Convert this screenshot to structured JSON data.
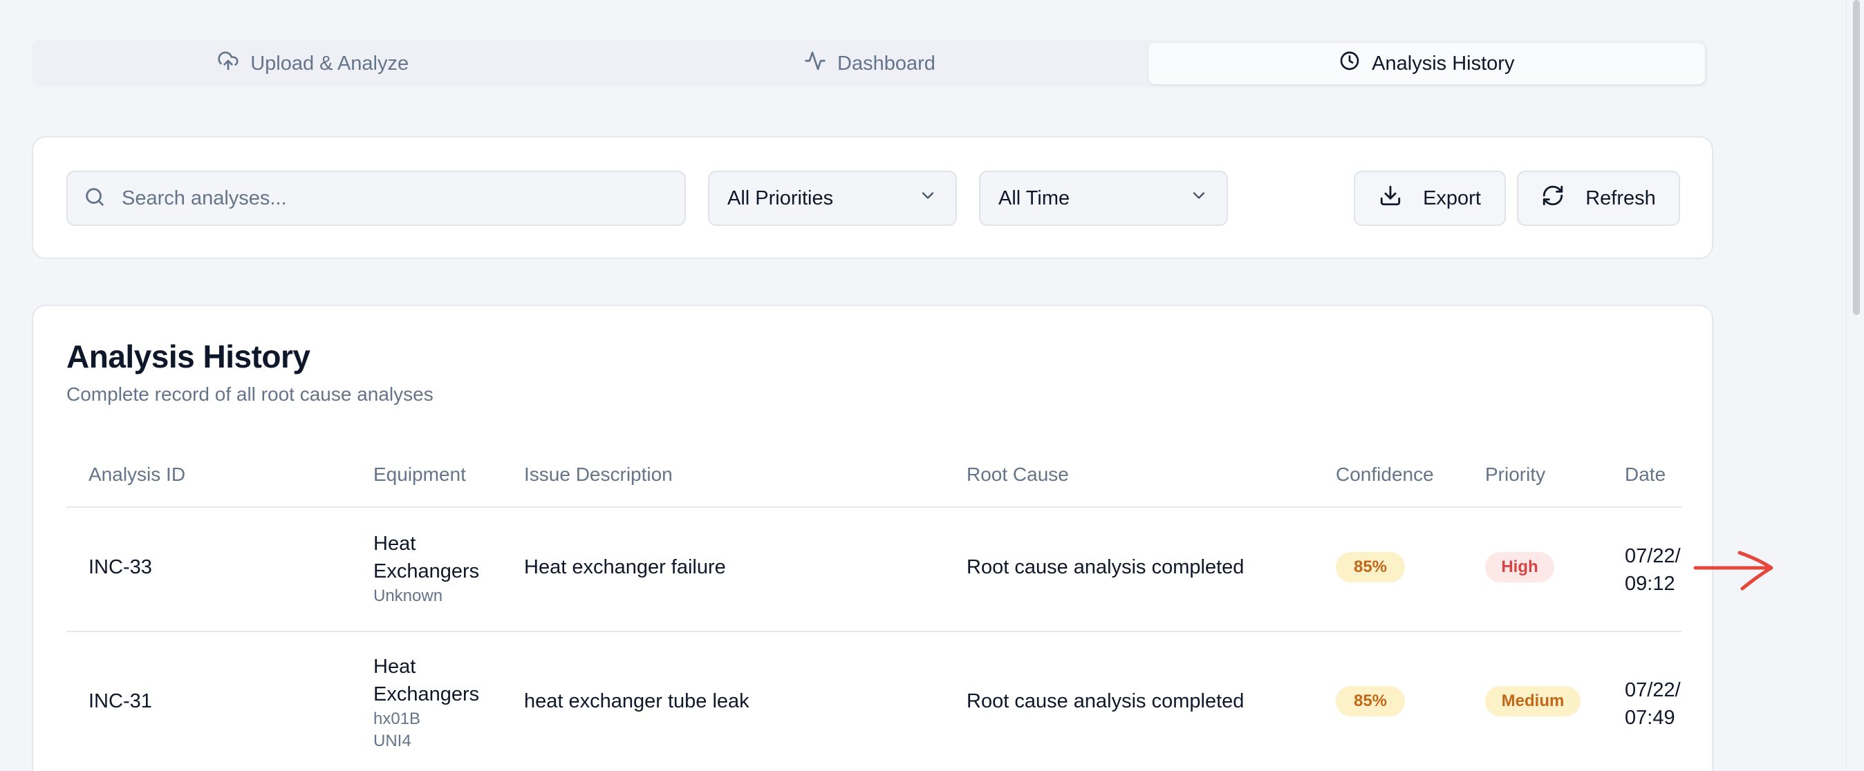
{
  "tabs": [
    {
      "label": "Upload & Analyze",
      "icon": "cloud-upload-icon"
    },
    {
      "label": "Dashboard",
      "icon": "activity-icon"
    },
    {
      "label": "Analysis History",
      "icon": "clock-icon",
      "active": true
    }
  ],
  "filters": {
    "search_placeholder": "Search analyses...",
    "priority_value": "All Priorities",
    "time_value": "All Time",
    "export_label": "Export",
    "refresh_label": "Refresh"
  },
  "history": {
    "title": "Analysis History",
    "subtitle": "Complete record of all root cause analyses",
    "columns": [
      "Analysis ID",
      "Equipment",
      "Issue Description",
      "Root Cause",
      "Confidence",
      "Priority",
      "Date"
    ],
    "rows": [
      {
        "id": "INC-33",
        "equipment_line1": "Heat",
        "equipment_line2": "Exchangers",
        "equipment_sub": [
          "Unknown"
        ],
        "issue": "Heat exchanger failure",
        "root_cause": "Root cause analysis completed",
        "confidence": "85%",
        "priority": "High",
        "date_line1": "07/22/",
        "date_line2": "09:12"
      },
      {
        "id": "INC-31",
        "equipment_line1": "Heat",
        "equipment_line2": "Exchangers",
        "equipment_sub": [
          "hx01B",
          "UNI4"
        ],
        "issue": "heat exchanger tube leak",
        "root_cause": "Root cause analysis completed",
        "confidence": "85%",
        "priority": "Medium",
        "date_line1": "07/22/",
        "date_line2": "07:49"
      }
    ]
  },
  "colors": {
    "accent_red": "#e5473a",
    "priority_high": "#d64545",
    "priority_medium": "#c2681b"
  }
}
